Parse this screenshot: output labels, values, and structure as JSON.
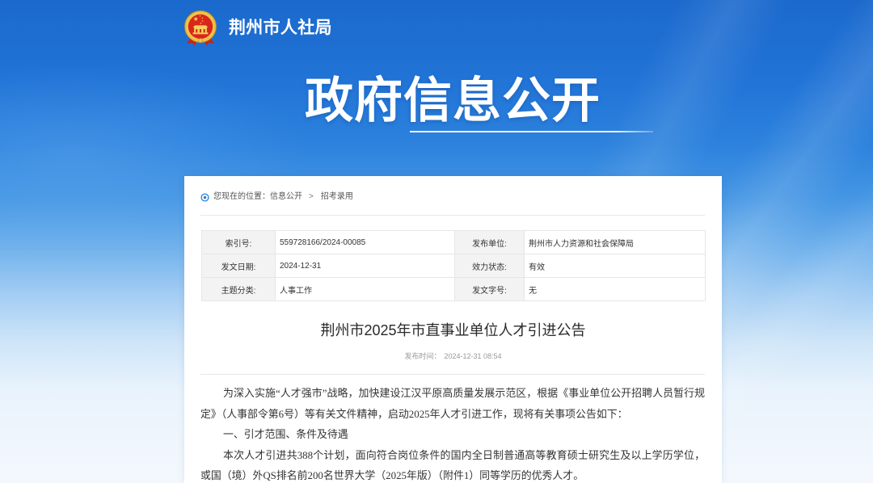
{
  "header": {
    "site_name": "荆州市人社局",
    "banner_title": "政府信息公开"
  },
  "breadcrumb": {
    "prefix": "您现在的位置：",
    "items": [
      "信息公开",
      "招考录用"
    ],
    "separator": ">"
  },
  "info_table": {
    "rows": [
      [
        {
          "label": "索引号:",
          "value": "559728166/2024-00085"
        },
        {
          "label": "发布单位:",
          "value": "荆州市人力资源和社会保障局"
        }
      ],
      [
        {
          "label": "发文日期:",
          "value": "2024-12-31"
        },
        {
          "label": "效力状态:",
          "value": "有效"
        }
      ],
      [
        {
          "label": "主题分类:",
          "value": "人事工作"
        },
        {
          "label": "发文字号:",
          "value": "无"
        }
      ]
    ]
  },
  "article": {
    "title": "荆州市2025年市直事业单位人才引进公告",
    "publish_label": "发布时间：",
    "publish_time": "2024-12-31 08:54",
    "paragraphs": [
      "为深入实施“人才强市”战略，加快建设江汉平原高质量发展示范区，根据《事业单位公开招聘人员暂行规定》（人事部令第6号）等有关文件精神，启动2025年人才引进工作，现将有关事项公告如下：",
      "一、引才范围、条件及待遇",
      "本次人才引进共388个计划，面向符合岗位条件的国内全日制普通高等教育硕士研究生及以上学历学位，或国（境）外QS排名前200名世界大学（2025年版）（附件1）同等学历的优秀人才。"
    ]
  },
  "icons": {
    "logo": "national-emblem-icon",
    "breadcrumb": "location-pin-icon"
  },
  "colors": {
    "header_blue": "#1b69cd",
    "accent_blue": "#2b7fe0",
    "panel_bg": "#ffffff",
    "label_cell_bg": "#f3f3f3",
    "body_text": "#333333",
    "meta_text": "#999999"
  }
}
